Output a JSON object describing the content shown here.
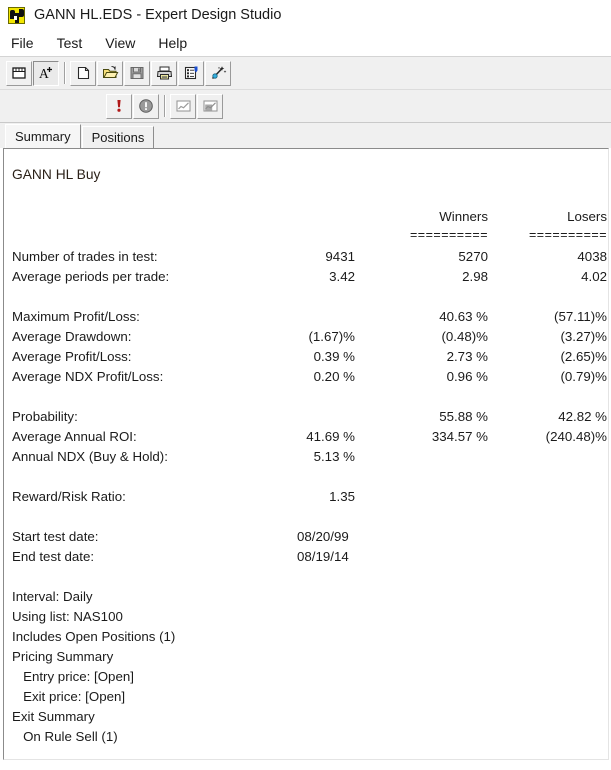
{
  "window": {
    "title": "GANN HL.EDS - Expert Design Studio",
    "icon": "app-checkered-icon"
  },
  "menubar": {
    "items": [
      {
        "label": "File",
        "name": "menu-file"
      },
      {
        "label": "Test",
        "name": "menu-test"
      },
      {
        "label": "View",
        "name": "menu-view"
      },
      {
        "label": "Help",
        "name": "menu-help"
      }
    ]
  },
  "toolbar_row1": [
    {
      "name": "window-list-icon",
      "state": "raised"
    },
    {
      "name": "font-increase-icon",
      "state": "sunken"
    },
    {
      "name": "new-document-icon",
      "state": "raised"
    },
    {
      "name": "open-folder-icon",
      "state": "raised"
    },
    {
      "name": "save-disk-icon",
      "state": "raised"
    },
    {
      "name": "print-icon",
      "state": "raised"
    },
    {
      "name": "print-preview-icon",
      "state": "raised"
    },
    {
      "name": "wizard-wand-icon",
      "state": "raised"
    }
  ],
  "toolbar_row2": [
    {
      "name": "run-exclamation-icon",
      "state": "raised"
    },
    {
      "name": "info-circle-icon",
      "state": "raised"
    },
    {
      "name": "line-chart-icon",
      "state": "raised"
    },
    {
      "name": "area-chart-icon",
      "state": "raised"
    }
  ],
  "tabs": [
    {
      "label": "Summary",
      "name": "tab-summary",
      "active": true
    },
    {
      "label": "Positions",
      "name": "tab-positions",
      "active": false
    }
  ],
  "report": {
    "strategy_title": "GANN HL Buy",
    "columns": {
      "winners": "Winners",
      "losers": "Losers",
      "rule": "=========="
    },
    "rows": [
      {
        "label": "Number of trades in test:",
        "total": "9431",
        "winners": "5270",
        "losers": "4038"
      },
      {
        "label": "Average periods per trade:",
        "total": "3.42",
        "winners": "2.98",
        "losers": "4.02"
      },
      {
        "label": "Maximum Profit/Loss:",
        "total": "",
        "winners": "40.63 %",
        "losers": "(57.11)%"
      },
      {
        "label": "Average Drawdown:",
        "total": "(1.67)%",
        "winners": "(0.48)%",
        "losers": "(3.27)%"
      },
      {
        "label": "Average Profit/Loss:",
        "total": "0.39 %",
        "winners": "2.73 %",
        "losers": "(2.65)%"
      },
      {
        "label": "Average NDX Profit/Loss:",
        "total": "0.20 %",
        "winners": "0.96 %",
        "losers": "(0.79)%"
      },
      {
        "label": "Probability:",
        "total": "",
        "winners": "55.88 %",
        "losers": "42.82 %"
      },
      {
        "label": "Average Annual ROI:",
        "total": "41.69 %",
        "winners": "334.57 %",
        "losers": "(240.48)%"
      },
      {
        "label": "Annual NDX (Buy & Hold):",
        "total": "5.13 %",
        "winners": "",
        "losers": ""
      },
      {
        "label": "Reward/Risk Ratio:",
        "total": "1.35",
        "winners": "",
        "losers": ""
      }
    ],
    "dates": [
      {
        "label": "Start test date:",
        "value": "08/20/99"
      },
      {
        "label": "End test date:",
        "value": "08/19/14"
      }
    ],
    "footer_lines": [
      "Interval: Daily",
      "Using list: NAS100",
      "Includes Open Positions (1)",
      "Pricing Summary",
      "   Entry price: [Open]",
      "   Exit price: [Open]",
      "Exit Summary",
      "   On Rule Sell (1)"
    ]
  }
}
